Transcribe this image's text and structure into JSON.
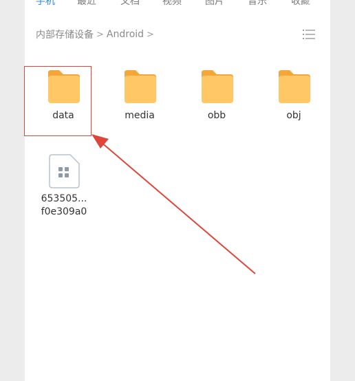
{
  "tabs": [
    {
      "label": "手机",
      "active": true
    },
    {
      "label": "最近",
      "active": false
    },
    {
      "label": "文档",
      "active": false
    },
    {
      "label": "视频",
      "active": false
    },
    {
      "label": "图片",
      "active": false
    },
    {
      "label": "音乐",
      "active": false
    },
    {
      "label": "收藏",
      "active": false
    }
  ],
  "breadcrumb": {
    "root": "内部存储设备",
    "current": "Android",
    "separator": ">"
  },
  "folders": [
    {
      "name": "data"
    },
    {
      "name": "media"
    },
    {
      "name": "obb"
    },
    {
      "name": "obj"
    }
  ],
  "files": [
    {
      "name_line1": "653505...",
      "name_line2": "f0e309a0",
      "icon": "document-icon"
    }
  ],
  "annotation": {
    "color": "#e0453a",
    "target": "data"
  },
  "colors": {
    "accent": "#2f88f5",
    "folder": "#ffc766",
    "folder_tab": "#f4a63a"
  }
}
